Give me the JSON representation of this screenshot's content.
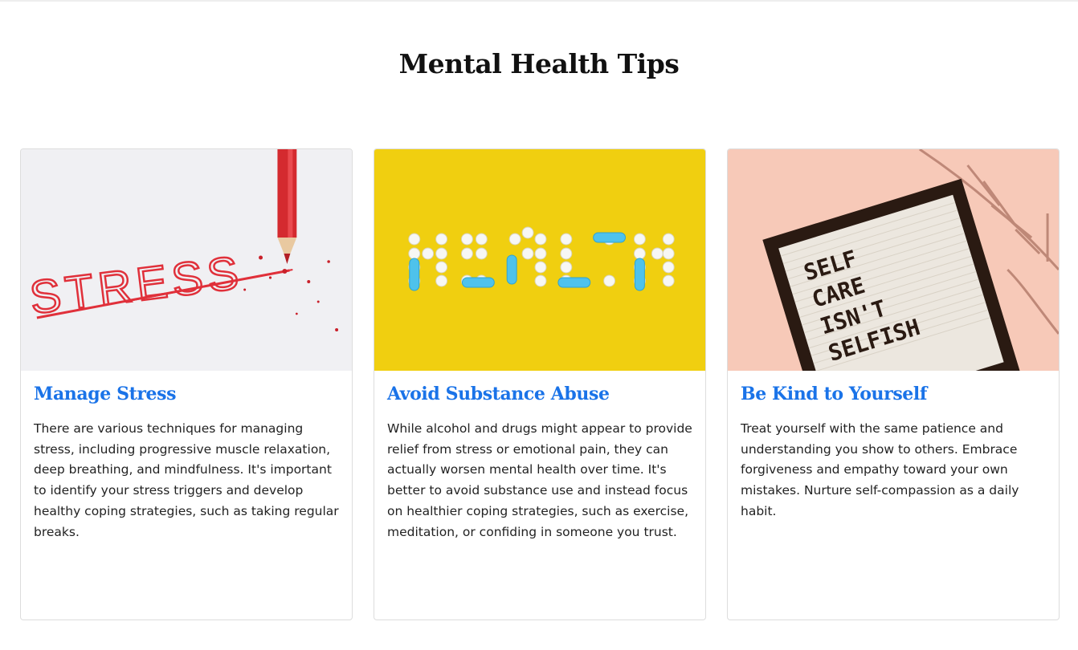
{
  "page": {
    "title": "Mental Health Tips"
  },
  "cards": [
    {
      "title": "Manage Stress",
      "text": "There are various techniques for managing stress, including progressive muscle relaxation, deep breathing, and mindfulness. It's important to identify your stress triggers and develop healthy coping strategies, such as taking regular breaks.",
      "image_word": "STRESS",
      "image_bg": "#ececee",
      "accent": "#e0303a"
    },
    {
      "title": "Avoid Substance Abuse",
      "text": "While alcohol and drugs might appear to provide relief from stress or emotional pain, they can actually worsen mental health over time. It's better to avoid substance use and instead focus on healthier coping strategies, such as exercise, meditation, or confiding in someone you trust.",
      "image_word": "HEALTH",
      "image_bg": "#f0cf10",
      "accent": "#4ec2ec"
    },
    {
      "title": "Be Kind to Yourself",
      "text": "Treat yourself with the same patience and understanding you show to others. Embrace forgiveness and empathy toward your own mistakes. Nurture self-compassion as a daily habit.",
      "image_lines": [
        "SELF",
        "CARE",
        "ISN'T",
        "SELFISH"
      ],
      "image_bg": "#f7c9b8",
      "accent": "#2a1a12"
    }
  ]
}
